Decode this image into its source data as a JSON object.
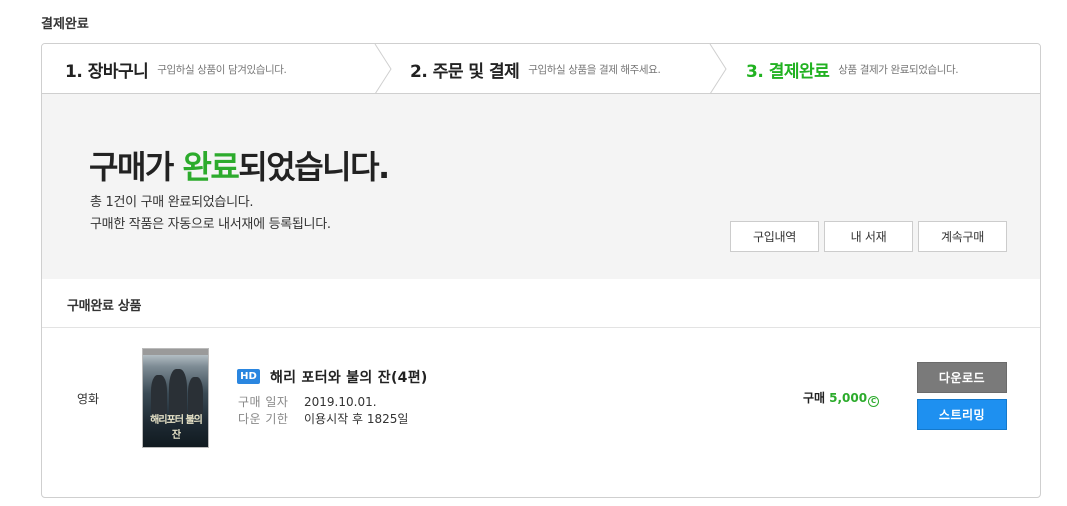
{
  "page": {
    "title": "결제완료"
  },
  "steps": [
    {
      "label": "1. 장바구니",
      "desc": "구입하실 상품이 담겨있습니다."
    },
    {
      "label": "2. 주문 및 결제",
      "desc": "구입하실 상품을 결제 해주세요."
    },
    {
      "label": "3. 결제완료",
      "desc": "상품 결제가 완료되었습니다."
    }
  ],
  "active_step": 3,
  "colors": {
    "accent_green": "#2cab2c",
    "stream_blue": "#1e90f0",
    "download_gray": "#7a7a7a"
  },
  "hero": {
    "headline_pre": "구매가 ",
    "headline_accent": "완료",
    "headline_post": "되었습니다.",
    "line1": "총 1건이 구매 완료되었습니다.",
    "line2": "구매한 작품은 자동으로 내서재에 등록됩니다.",
    "buttons": {
      "history": "구입내역",
      "library": "내 서재",
      "continue": "계속구매"
    }
  },
  "section": {
    "title": "구매완료 상품"
  },
  "item": {
    "category": "영화",
    "poster_title": "해리포터 불의 잔",
    "badge": "HD",
    "title": "해리 포터와 불의 잔(4편)",
    "purchase_date_label": "구매 일자",
    "purchase_date": "2019.10.01.",
    "download_period_label": "다운 기한",
    "download_period": "이용시작 후 1825일",
    "price_label": "구매",
    "price": "5,000",
    "currency_icon": "cash-icon",
    "currency_symbol": "C",
    "download_label": "다운로드",
    "stream_label": "스트리밍"
  }
}
